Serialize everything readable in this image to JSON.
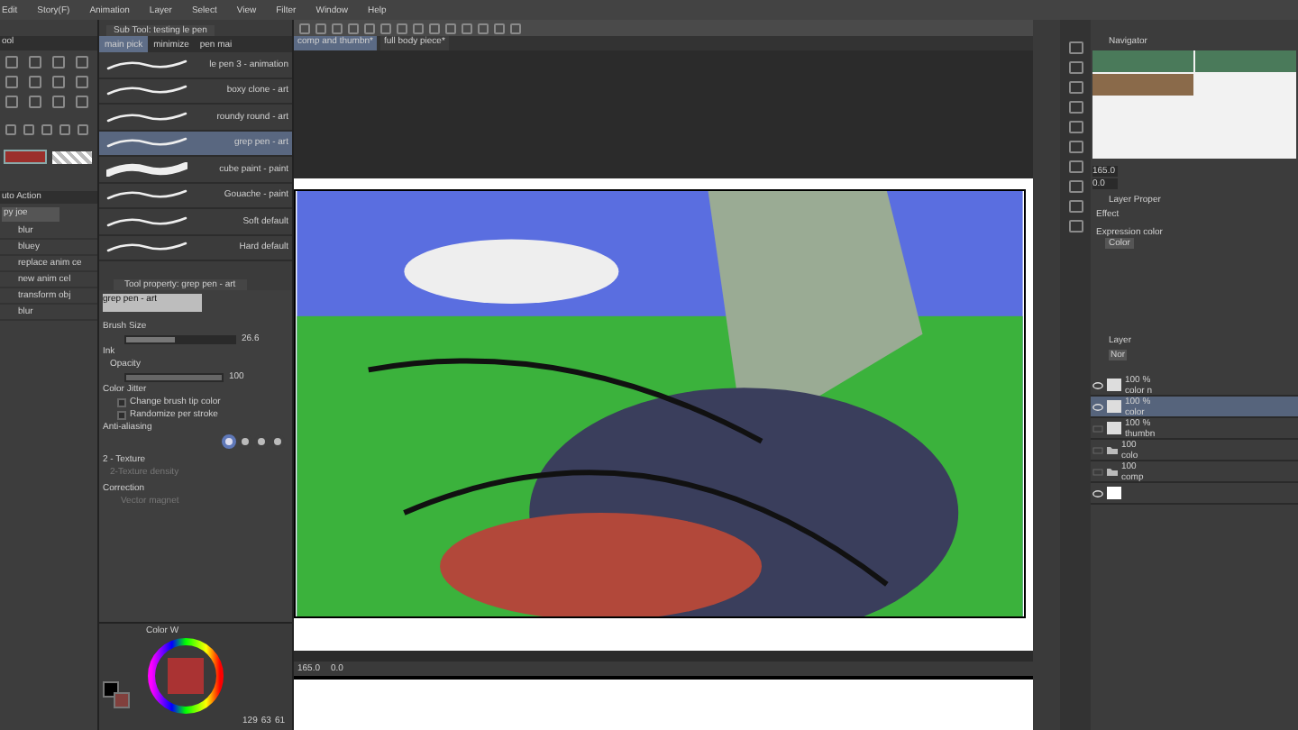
{
  "menu": [
    "Edit",
    "Story(F)",
    "Animation",
    "Layer",
    "Select",
    "View",
    "Filter",
    "Window",
    "Help"
  ],
  "tool_panel": {
    "title": "ool"
  },
  "sub_tool": {
    "title": "Sub Tool: testing le pen",
    "groups": [
      {
        "label": "main pick",
        "selected": true
      },
      {
        "label": "minimize",
        "selected": false
      },
      {
        "label": "pen mai",
        "selected": false
      }
    ],
    "brushes": [
      {
        "name": "le pen 3 - animation",
        "selected": false
      },
      {
        "name": "boxy clone - art",
        "selected": false
      },
      {
        "name": "roundy round - art",
        "selected": false
      },
      {
        "name": "grep pen - art",
        "selected": true
      },
      {
        "name": "cube paint - paint",
        "selected": false
      },
      {
        "name": "Gouache - paint",
        "selected": false
      },
      {
        "name": "Soft default",
        "selected": false
      },
      {
        "name": "Hard default",
        "selected": false
      }
    ]
  },
  "auto_action": {
    "title": "uto Action",
    "set": "py joe",
    "items": [
      "blur",
      "bluey",
      "replace anim ce",
      "new anim cel",
      "transform obj",
      "blur"
    ]
  },
  "document_tabs": [
    {
      "label": "comp and thumbn*",
      "selected": true
    },
    {
      "label": "full body piece*",
      "selected": false
    }
  ],
  "tool_property": {
    "title": "Tool property: grep pen - art",
    "preview_label": "grep pen - art",
    "brush_size": {
      "label": "Brush Size",
      "value": "26.6",
      "level": 0.45
    },
    "ink": "Ink",
    "opacity": {
      "label": "Opacity",
      "value": "100",
      "level": 1
    },
    "color_jitter": "Color Jitter",
    "checkboxes": [
      {
        "label": "Change brush tip color",
        "checked": false
      },
      {
        "label": "Randomize per stroke",
        "checked": false
      }
    ],
    "anti_aliasing": "Anti-aliasing",
    "anti_aliasing_options": [
      {
        "selected": true
      },
      {
        "selected": false
      },
      {
        "selected": false
      },
      {
        "selected": false
      }
    ],
    "texture": "2 - Texture",
    "texture_density": {
      "label": "2-Texture density",
      "disabled": true
    },
    "correction": "Correction",
    "vector_magnet": {
      "label": "Vector magnet",
      "disabled": true
    }
  },
  "color_panel": {
    "tab": "Color W",
    "r": "129",
    "g": "63",
    "b": "61"
  },
  "status_bar": {
    "zoom": "165.0",
    "angle": "0.0"
  },
  "navigator": {
    "title": "Navigator",
    "zoom": "165.0",
    "angle": "0.0"
  },
  "layer_property": {
    "title": "Layer Proper",
    "effect": "Effect",
    "expression_color": "Expression color",
    "color_mode": "Color"
  },
  "layers": {
    "title": "Layer",
    "blend": "Nor",
    "items": [
      {
        "kind": "layer",
        "opacity": "100 %",
        "name": "color n",
        "visible": true,
        "selected": false
      },
      {
        "kind": "layer",
        "opacity": "100 %",
        "name": "color",
        "visible": true,
        "selected": true
      },
      {
        "kind": "layer",
        "opacity": "100 %",
        "name": "thumbn",
        "visible": false,
        "selected": false
      },
      {
        "kind": "folder",
        "opacity": "100",
        "name": "colo",
        "visible": false,
        "selected": false
      },
      {
        "kind": "folder",
        "opacity": "100",
        "name": "comp",
        "visible": false,
        "selected": false
      },
      {
        "kind": "paper",
        "visible": true,
        "selected": false
      }
    ]
  }
}
